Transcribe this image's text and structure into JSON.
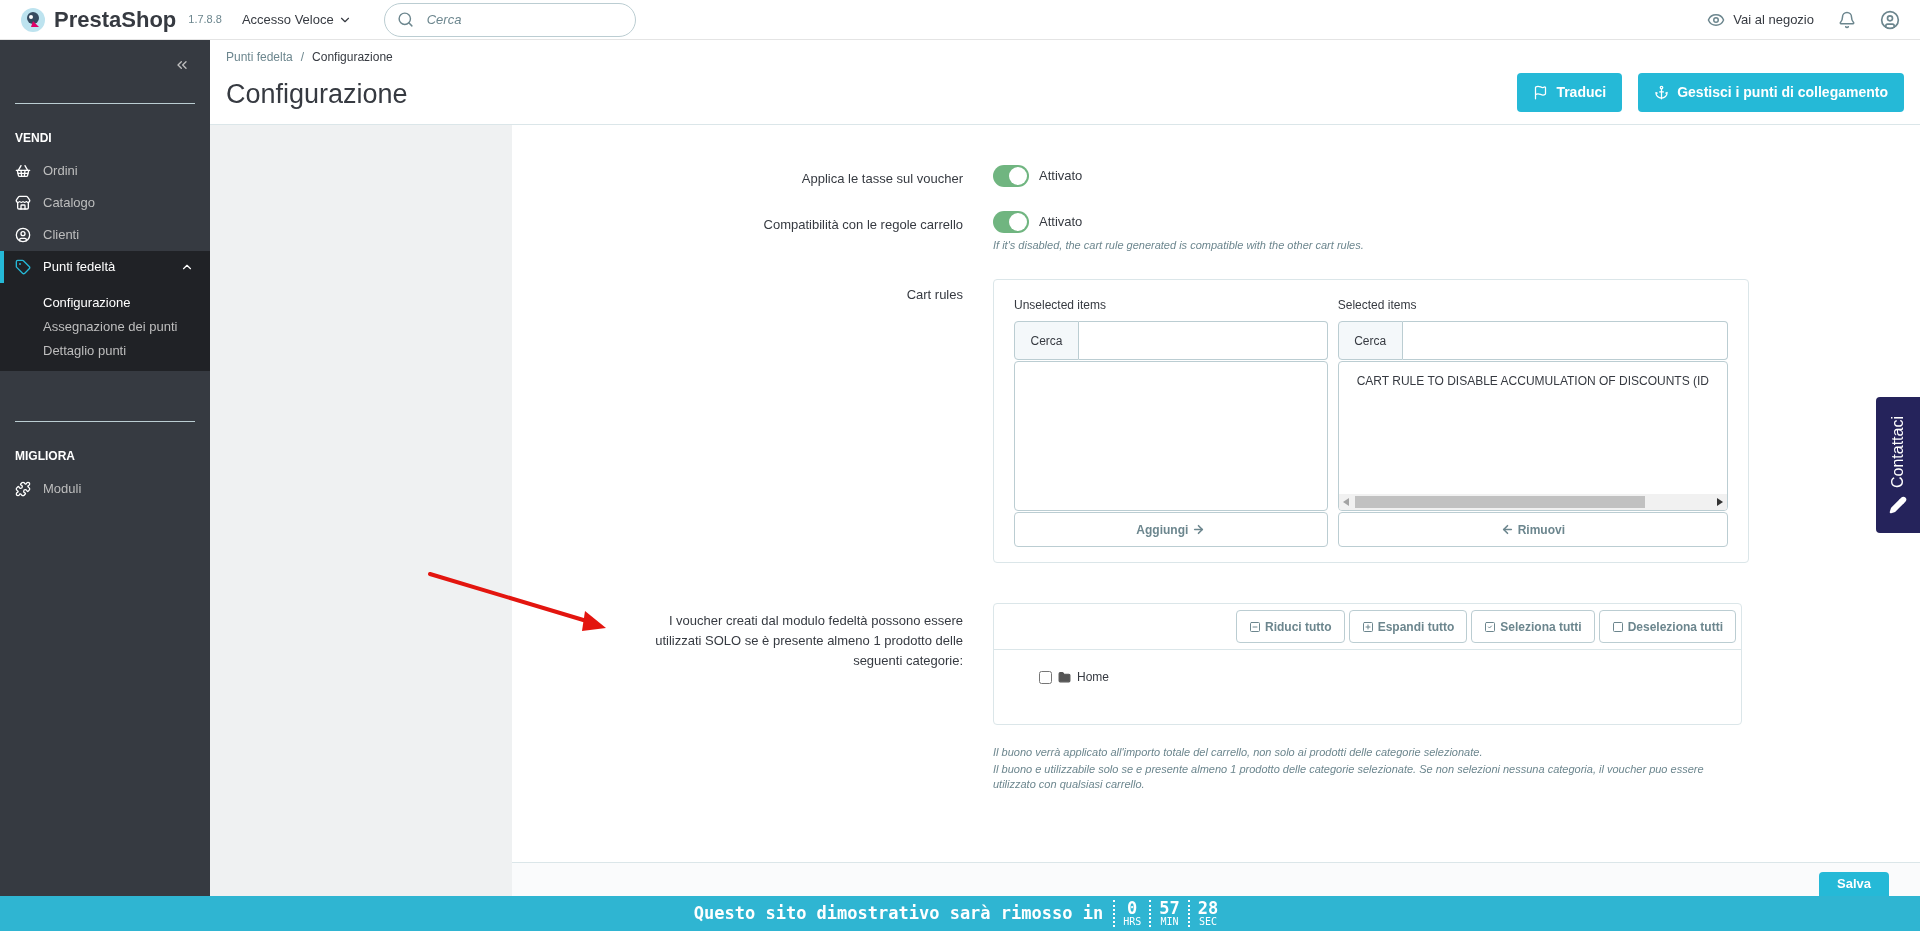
{
  "header": {
    "brand": "PrestaShop",
    "version": "1.7.8.8",
    "quick_access": "Accesso Veloce",
    "search": {
      "placeholder": "Cerca"
    },
    "shop_link": "Vai al negozio"
  },
  "sidebar": {
    "sections": [
      {
        "title": "VENDI",
        "items": [
          {
            "label": "Ordini",
            "selected": false
          },
          {
            "label": "Catalogo",
            "selected": false
          },
          {
            "label": "Clienti",
            "selected": false
          },
          {
            "label": "Punti fedeltà",
            "selected": true,
            "expanded": true,
            "children": [
              {
                "label": "Configurazione",
                "selected": true
              },
              {
                "label": "Assegnazione dei punti",
                "selected": false
              },
              {
                "label": "Dettaglio punti",
                "selected": false
              }
            ]
          }
        ]
      },
      {
        "title": "MIGLIORA",
        "items": [
          {
            "label": "Moduli",
            "selected": false
          }
        ]
      }
    ]
  },
  "breadcrumb": {
    "items": [
      "Punti fedelta",
      "Configurazione"
    ],
    "separator": "/"
  },
  "page_title": "Configurazione",
  "toolbar": [
    "Traduci",
    "Gestisci i punti di collegamento"
  ],
  "switches": [
    {
      "label": "Applica le tasse sul voucher",
      "on": true,
      "state_text": "Attivato"
    },
    {
      "label": "Compatibilità con le regole carrello",
      "on": true,
      "state_text": "Attivato",
      "help": "If it's disabled, the cart rule generated is compatible with the other cart rules."
    }
  ],
  "cart_rules": {
    "label": "Cart rules",
    "lists": [
      {
        "title": "Unselected items",
        "search_label": "Cerca",
        "button": "Aggiungi"
      },
      {
        "title": "Selected items",
        "search_label": "Cerca",
        "items": [
          "CART RULE TO DISABLE ACCUMULATION OF DISCOUNTS (ID"
        ],
        "button": "Rimuovi"
      }
    ]
  },
  "categories": {
    "label": "I voucher creati dal modulo fedeltà possono essere utilizzati SOLO se è presente almeno 1 prodotto delle seguenti categorie:",
    "buttons": [
      "Riduci tutto",
      "Espandi tutto",
      "Seleziona tutti",
      "Deseleziona tutti"
    ],
    "tree": [
      {
        "label": "Home",
        "checked": false
      }
    ],
    "help": [
      "Il buono verrà applicato all'importo totale del carrello, non solo ai prodotti delle categorie selezionate.",
      "Il buono e utilizzabile solo se e presente almeno 1 prodotto delle categorie selezionate. Se non selezioni nessuna categoria, il voucher puo essere utilizzato con qualsiasi carrello."
    ]
  },
  "save_button": "Salva",
  "contact_tab": "Contattaci",
  "countdown": {
    "text": "Questo sito dimostrativo sarà rimosso in",
    "units": [
      {
        "value": "0",
        "unit": "HRS"
      },
      {
        "value": "57",
        "unit": "MIN"
      },
      {
        "value": "28",
        "unit": "SEC"
      }
    ]
  }
}
